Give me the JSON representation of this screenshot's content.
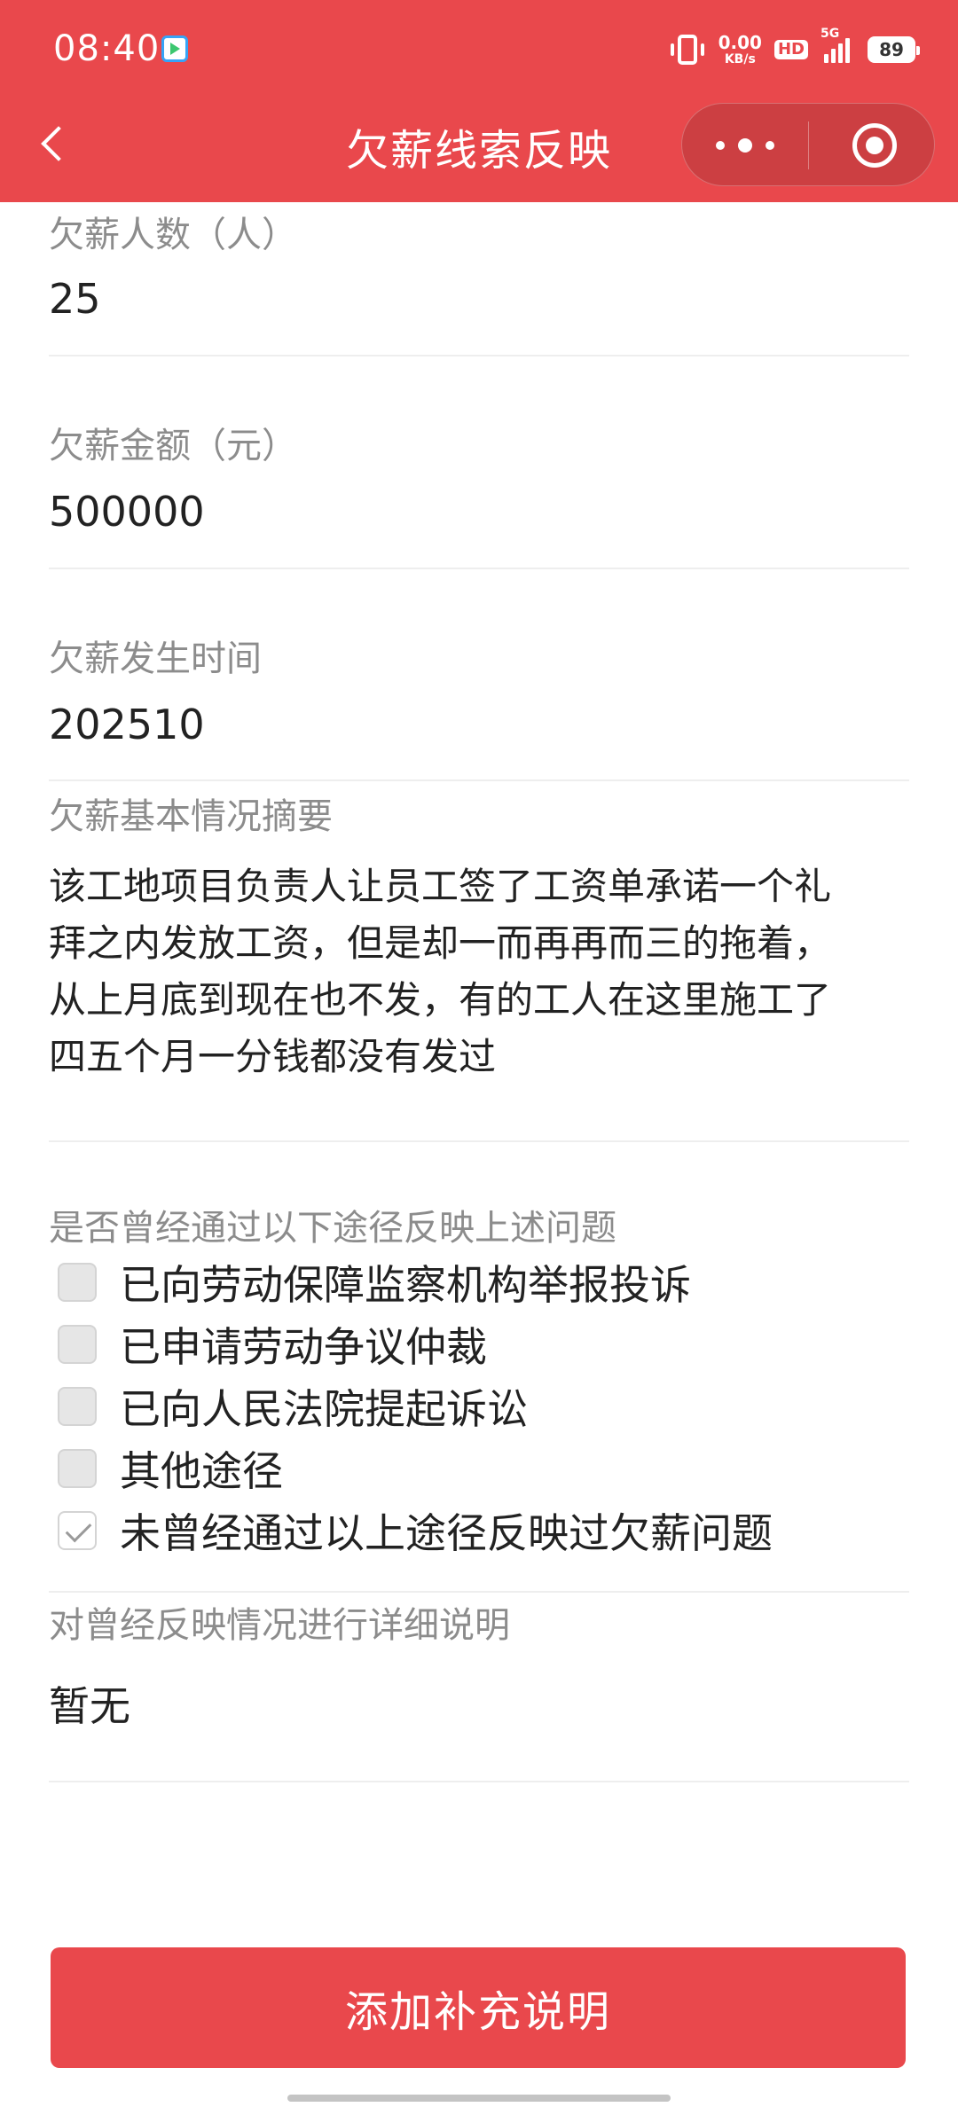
{
  "theme": {
    "accent": "#e9484c"
  },
  "status_bar": {
    "time": "08:40",
    "net_speed_value": "0.00",
    "net_speed_unit": "KB/s",
    "hd_label": "HD",
    "signal_label": "5G",
    "battery_level": "89",
    "icons": [
      "app-notification-icon",
      "vibrate-icon",
      "hd-icon",
      "signal-icon",
      "battery-icon"
    ]
  },
  "nav": {
    "title": "欠薪线索反映",
    "back_icon": "chevron-left-icon",
    "more_icon": "more-dots-icon",
    "close_icon": "target-circle-icon"
  },
  "form": {
    "workers_count": {
      "label": "欠薪人数（人）",
      "value": "25"
    },
    "amount": {
      "label": "欠薪金额（元）",
      "value": "500000"
    },
    "occurrence_time": {
      "label": "欠薪发生时间",
      "value": "202510"
    },
    "summary": {
      "label": "欠薪基本情况摘要",
      "lines": [
        "该工地项目负责人让员工签了工资单承诺一个礼",
        "拜之内发放工资，但是却一而再再而三的拖着，",
        "从上月底到现在也不发，有的工人在这里施工了",
        "四五个月一分钱都没有发过"
      ]
    },
    "channels": {
      "label": "是否曾经通过以下途径反映上述问题",
      "options": [
        {
          "label": "已向劳动保障监察机构举报投诉",
          "checked": false
        },
        {
          "label": "已申请劳动争议仲裁",
          "checked": false
        },
        {
          "label": "已向人民法院提起诉讼",
          "checked": false
        },
        {
          "label": "其他途径",
          "checked": false
        },
        {
          "label": "未曾经通过以上途径反映过欠薪问题",
          "checked": true
        }
      ]
    },
    "detail": {
      "label": "对曾经反映情况进行详细说明",
      "value": "暂无"
    }
  },
  "submit": {
    "label": "添加补充说明"
  }
}
